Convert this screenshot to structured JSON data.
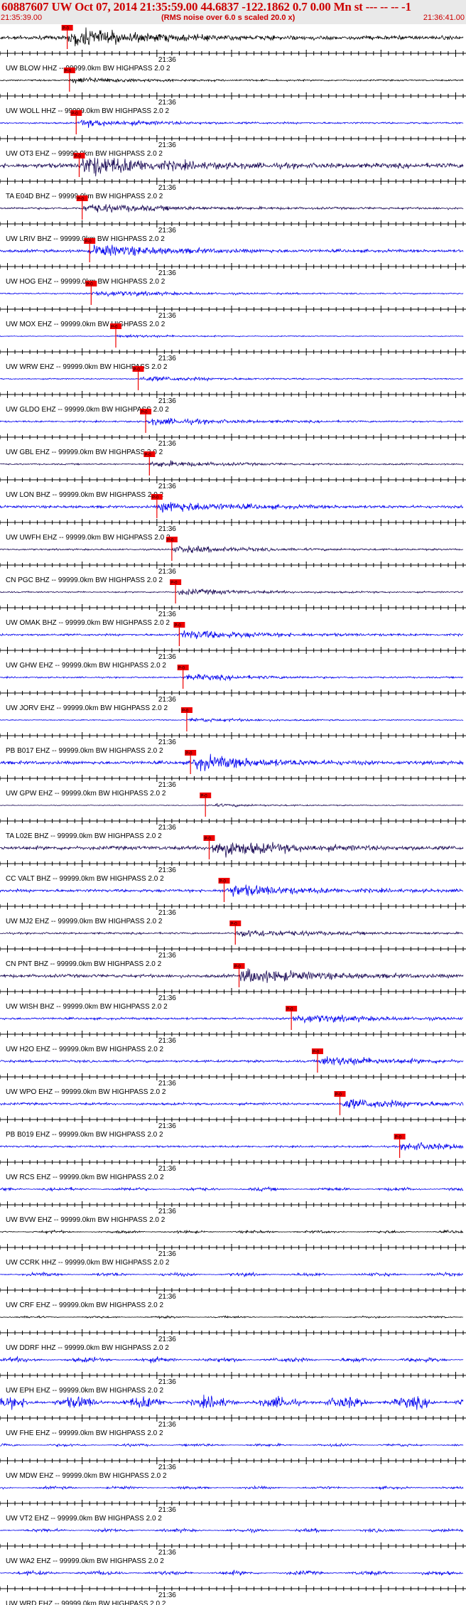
{
  "header": {
    "title": "60887607 UW Oct 07, 2014 21:35:59.00   44.6837 -122.1862  0.7 0.00 Mn st --- -- -- -1",
    "time_start": "21:35:39.00",
    "noise_note": "(RMS noise over 6.0 s scaled 20.0 x)",
    "time_end": "21:36:41.00"
  },
  "colors": {
    "title": "#cc0000",
    "trace_black": "#000000",
    "trace_blue": "#0000ee",
    "trace_purple": "#1a0a55",
    "pick": "#ee0000",
    "header_bg": "#e9e9e9"
  },
  "chart_data": {
    "type": "line",
    "description_units": "time axis in seconds after 21:35:39.00",
    "x_range_seconds": [
      0,
      62
    ],
    "minute_mark": "21:36",
    "minute_mark_seconds": 21,
    "channel_suffix": "-- 99999.0km BW  HIGHPASS  2.0  2",
    "channels": [
      {
        "name": "UW BLOW HHZ",
        "color": "black",
        "amplitude": 0.85,
        "pick_s": 9.0,
        "pick_label": "P-0"
      },
      {
        "name": "UW WOLL HHZ",
        "color": "black",
        "amplitude": 0.3,
        "pick_s": 9.3,
        "pick_label": "P-0"
      },
      {
        "name": "UW OT3 EHZ",
        "color": "blue",
        "amplitude": 0.35,
        "pick_s": 10.2,
        "pick_label": "P-0"
      },
      {
        "name": "TA E04D BHZ",
        "color": "purple",
        "amplitude": 1.0,
        "pick_s": 10.6,
        "pick_label": "P-0"
      },
      {
        "name": "UW LRIV BHZ",
        "color": "purple",
        "amplitude": 0.45,
        "pick_s": 11.0,
        "pick_label": "P-0"
      },
      {
        "name": "UW HOG EHZ",
        "color": "blue",
        "amplitude": 0.6,
        "pick_s": 12.0,
        "pick_label": "P-0"
      },
      {
        "name": "UW MOX EHZ",
        "color": "blue",
        "amplitude": 0.3,
        "pick_s": 12.2,
        "pick_label": "P-0"
      },
      {
        "name": "UW WRW EHZ",
        "color": "blue",
        "amplitude": 0.15,
        "pick_s": 15.5,
        "pick_label": "P-0"
      },
      {
        "name": "UW GLDO EHZ",
        "color": "blue",
        "amplitude": 0.25,
        "pick_s": 18.5,
        "pick_label": "P-0"
      },
      {
        "name": "UW GBL EHZ",
        "color": "blue",
        "amplitude": 0.35,
        "pick_s": 19.5,
        "pick_label": "P-0"
      },
      {
        "name": "UW LON BHZ",
        "color": "purple",
        "amplitude": 0.3,
        "pick_s": 20.0,
        "pick_label": "P-0"
      },
      {
        "name": "UW UWFH EHZ",
        "color": "blue",
        "amplitude": 0.55,
        "pick_s": 21.0,
        "pick_label": "P-0"
      },
      {
        "name": "CN PGC BHZ",
        "color": "purple",
        "amplitude": 0.35,
        "pick_s": 23.0,
        "pick_label": "P-0"
      },
      {
        "name": "UW OMAK BHZ",
        "color": "purple",
        "amplitude": 0.3,
        "pick_s": 23.5,
        "pick_label": "P-0"
      },
      {
        "name": "UW GHW EHZ",
        "color": "blue",
        "amplitude": 0.45,
        "pick_s": 24.0,
        "pick_label": "P-0"
      },
      {
        "name": "UW JORV EHZ",
        "color": "blue",
        "amplitude": 0.3,
        "pick_s": 24.5,
        "pick_label": "P-0"
      },
      {
        "name": "PB B017 EHZ",
        "color": "blue",
        "amplitude": 0.2,
        "pick_s": 25.0,
        "pick_label": "P-0"
      },
      {
        "name": "UW GPW EHZ",
        "color": "blue",
        "amplitude": 0.7,
        "pick_s": 25.5,
        "pick_label": "P-0"
      },
      {
        "name": "TA L02E BHZ",
        "color": "purple",
        "amplitude": 0.15,
        "pick_s": 27.5,
        "pick_label": "P-0"
      },
      {
        "name": "CC VALT BHZ",
        "color": "purple",
        "amplitude": 0.8,
        "pick_s": 28.0,
        "pick_label": "P-0"
      },
      {
        "name": "UW MJ2 EHZ",
        "color": "blue",
        "amplitude": 0.6,
        "pick_s": 30.0,
        "pick_label": "P-0"
      },
      {
        "name": "CN PNT BHZ",
        "color": "purple",
        "amplitude": 0.4,
        "pick_s": 31.5,
        "pick_label": "P-0"
      },
      {
        "name": "UW WISH BHZ",
        "color": "purple",
        "amplitude": 0.7,
        "pick_s": 32.0,
        "pick_label": "P-0"
      },
      {
        "name": "UW H2O EHZ",
        "color": "blue",
        "amplitude": 0.45,
        "pick_s": 39.0,
        "pick_label": "P-0"
      },
      {
        "name": "UW WPO EHZ",
        "color": "blue",
        "amplitude": 0.5,
        "pick_s": 42.5,
        "pick_label": "P-0"
      },
      {
        "name": "PB B019 EHZ",
        "color": "blue",
        "amplitude": 0.5,
        "pick_s": 45.5,
        "pick_label": "P-0"
      },
      {
        "name": "UW RCS EHZ",
        "color": "blue",
        "amplitude": 0.4,
        "pick_s": 53.5,
        "pick_label": "P-0"
      },
      {
        "name": "UW BVW EHZ",
        "color": "blue",
        "amplitude": 0.25,
        "pick_s": null,
        "pick_label": ""
      },
      {
        "name": "UW CCRK HHZ",
        "color": "black",
        "amplitude": 0.2,
        "pick_s": null,
        "pick_label": ""
      },
      {
        "name": "UW CRF EHZ",
        "color": "blue",
        "amplitude": 0.25,
        "pick_s": null,
        "pick_label": ""
      },
      {
        "name": "UW DDRF HHZ",
        "color": "black",
        "amplitude": 0.15,
        "pick_s": null,
        "pick_label": ""
      },
      {
        "name": "UW EPH EHZ",
        "color": "blue",
        "amplitude": 0.35,
        "pick_s": null,
        "pick_label": ""
      },
      {
        "name": "UW FHE EHZ",
        "color": "blue",
        "amplitude": 0.8,
        "pick_s": null,
        "pick_label": ""
      },
      {
        "name": "UW MDW EHZ",
        "color": "blue",
        "amplitude": 0.2,
        "pick_s": null,
        "pick_label": ""
      },
      {
        "name": "UW VT2 EHZ",
        "color": "blue",
        "amplitude": 0.2,
        "pick_s": null,
        "pick_label": ""
      },
      {
        "name": "UW WA2 EHZ",
        "color": "blue",
        "amplitude": 0.25,
        "pick_s": null,
        "pick_label": ""
      },
      {
        "name": "UW WRD EHZ",
        "color": "blue",
        "amplitude": 0.3,
        "pick_s": null,
        "pick_label": ""
      }
    ]
  }
}
